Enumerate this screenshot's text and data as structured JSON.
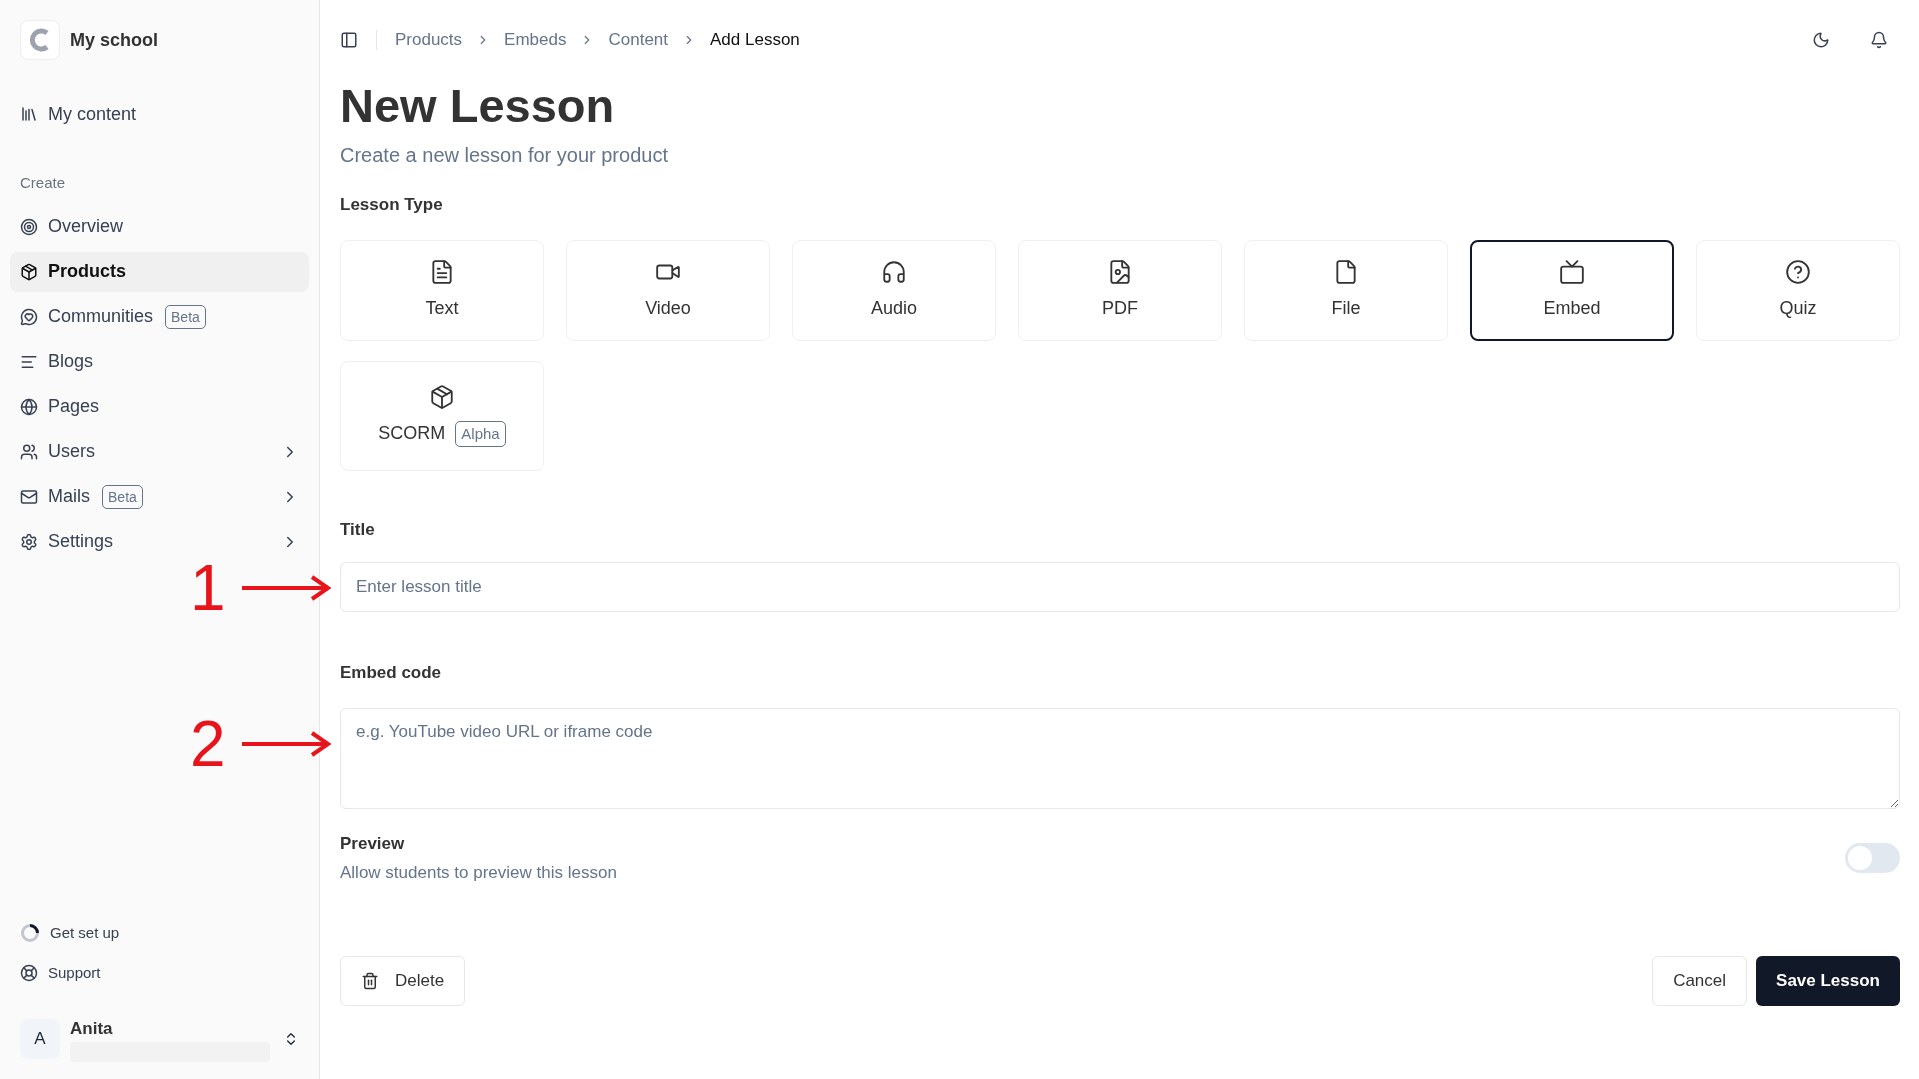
{
  "sidebar": {
    "school_name": "My school",
    "top_items": [
      {
        "label": "My content",
        "selected": false
      }
    ],
    "section_title": "Create",
    "items": [
      {
        "label": "Overview",
        "selected": false,
        "expandable": false
      },
      {
        "label": "Products",
        "selected": true,
        "expandable": false
      },
      {
        "label": "Communities",
        "selected": false,
        "expandable": false,
        "badge": "Beta"
      },
      {
        "label": "Blogs",
        "selected": false,
        "expandable": false
      },
      {
        "label": "Pages",
        "selected": false,
        "expandable": false
      },
      {
        "label": "Users",
        "selected": false,
        "expandable": true
      },
      {
        "label": "Mails",
        "selected": false,
        "expandable": true,
        "badge": "Beta"
      },
      {
        "label": "Settings",
        "selected": false,
        "expandable": true
      }
    ],
    "footer_items": [
      {
        "label": "Get set up"
      },
      {
        "label": "Support"
      }
    ],
    "user": {
      "initial": "A",
      "name": "Anita"
    }
  },
  "breadcrumbs": [
    "Products",
    "Embeds",
    "Content",
    "Add Lesson"
  ],
  "page": {
    "title": "New Lesson",
    "subtitle": "Create a new lesson for your product"
  },
  "lesson_type": {
    "label": "Lesson Type",
    "types": [
      {
        "label": "Text",
        "selected": false
      },
      {
        "label": "Video",
        "selected": false
      },
      {
        "label": "Audio",
        "selected": false
      },
      {
        "label": "PDF",
        "selected": false
      },
      {
        "label": "File",
        "selected": false
      },
      {
        "label": "Embed",
        "selected": true
      },
      {
        "label": "Quiz",
        "selected": false
      },
      {
        "label": "SCORM",
        "selected": false,
        "badge": "Alpha"
      }
    ]
  },
  "title_field": {
    "label": "Title",
    "placeholder": "Enter lesson title"
  },
  "embed_field": {
    "label": "Embed code",
    "placeholder": "e.g. YouTube video URL or iframe code"
  },
  "preview": {
    "label": "Preview",
    "description": "Allow students to preview this lesson",
    "on": false
  },
  "buttons": {
    "delete": "Delete",
    "cancel": "Cancel",
    "save": "Save Lesson"
  },
  "annotations": [
    {
      "label": "1"
    },
    {
      "label": "2"
    }
  ]
}
